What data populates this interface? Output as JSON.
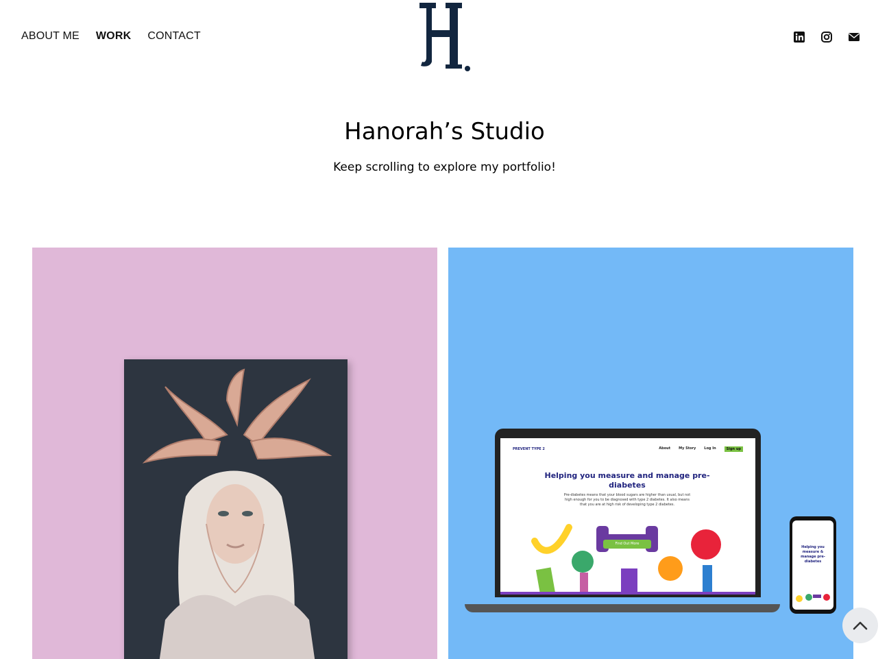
{
  "nav": {
    "items": [
      {
        "label": "ABOUT ME"
      },
      {
        "label": "WORK"
      },
      {
        "label": "CONTACT"
      }
    ]
  },
  "logo": {
    "letter": "H"
  },
  "social": {
    "icons": [
      "linkedin-icon",
      "instagram-icon",
      "envelope-icon"
    ]
  },
  "hero": {
    "title": "Hanorah’s Studio",
    "subtitle": "Keep scrolling to explore my portfolio!"
  },
  "project2": {
    "brand": "PREVENT TYPE 2",
    "nav": [
      "About",
      "My Story",
      "Log In"
    ],
    "signup": "Sign up",
    "headline": "Helping you measure and manage pre-diabetes",
    "body": "Pre-diabetes means that your blood sugars are higher than usual, but not high enough for you to be diagnosed with type 2 diabetes. It also means that you are at high risk of developing type 2 diabetes.",
    "cta": "Find Out More",
    "phone_headline": "Helping you measure & manage pre-diabetes"
  },
  "colors": {
    "left_card": "#e0b8d8",
    "right_card": "#73b9f7",
    "logo": "#12263f",
    "accent_green": "#7ac142",
    "brand_blue": "#20237e"
  }
}
